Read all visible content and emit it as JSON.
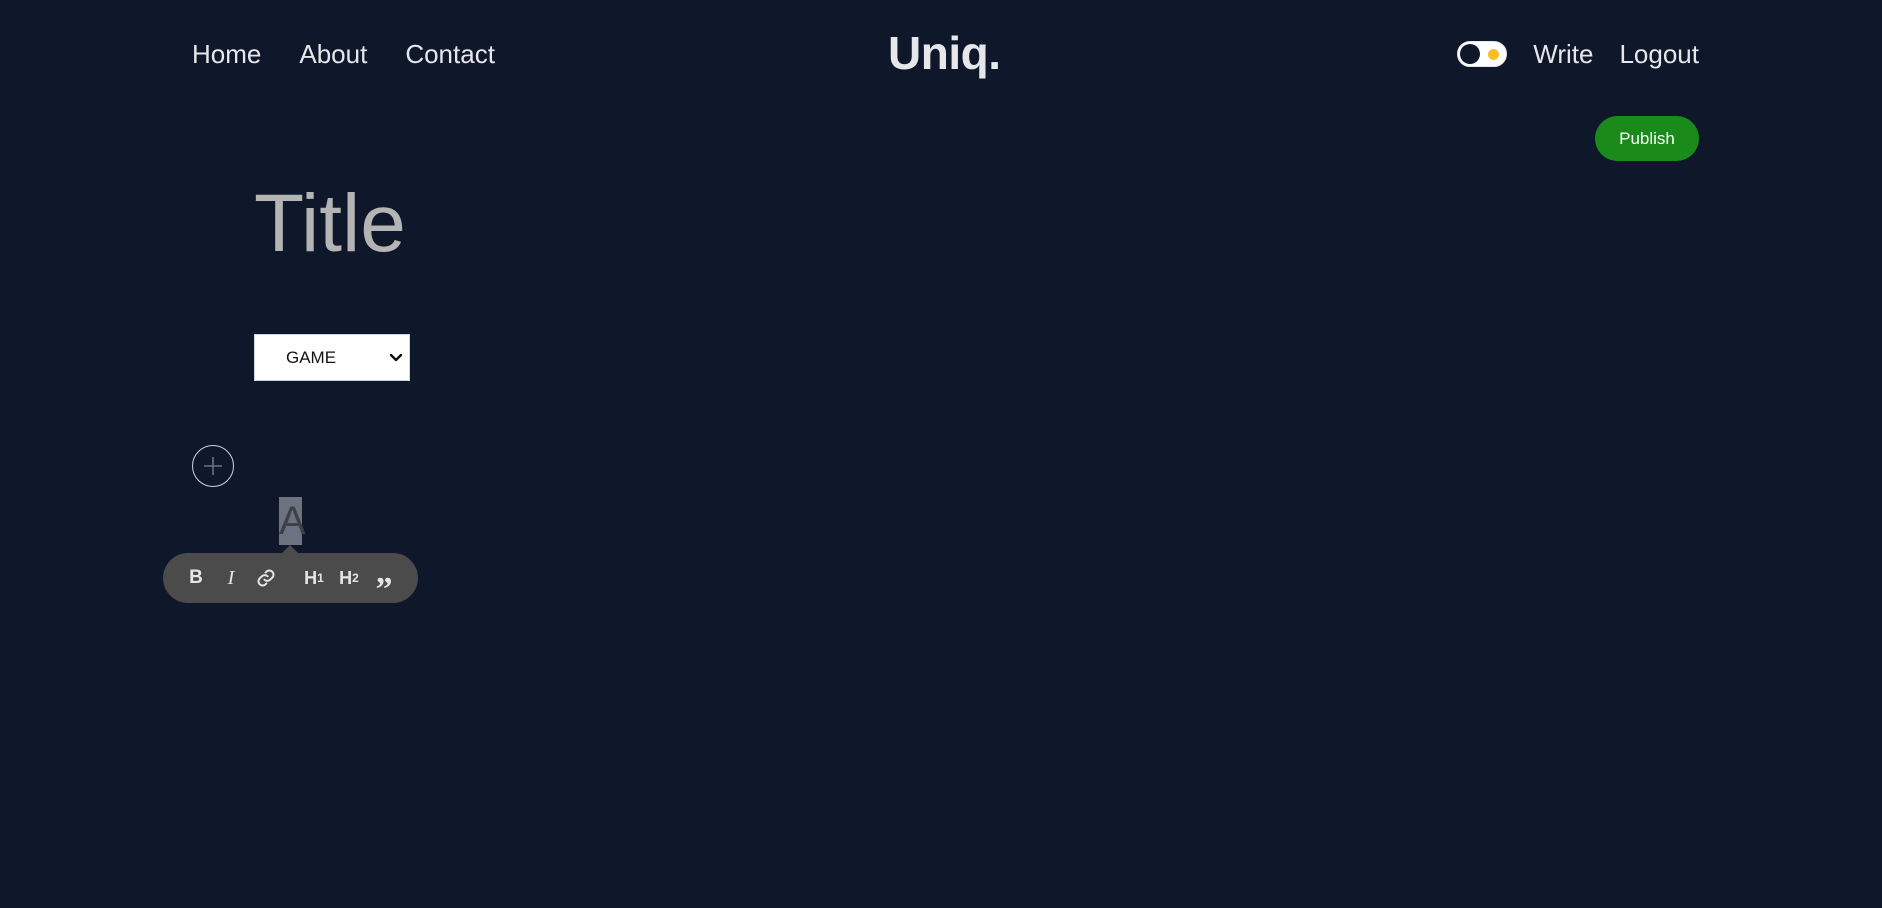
{
  "nav": {
    "links": [
      "Home",
      "About",
      "Contact"
    ],
    "logo": "Uniq.",
    "write_label": "Write",
    "logout_label": "Logout"
  },
  "publish": {
    "label": "Publish"
  },
  "editor": {
    "title_placeholder": "Title",
    "category": {
      "selected": "GAME"
    },
    "selected_text": "A",
    "toolbar": {
      "buttons": [
        "bold",
        "italic",
        "link",
        "heading-1",
        "heading-2",
        "quote"
      ],
      "bold_label": "B",
      "italic_label": "I",
      "h1_label": "H",
      "h1_sub": "1",
      "h2_label": "H",
      "h2_sub": "2",
      "quote_label": "”"
    }
  },
  "colors": {
    "background": "#0f172a",
    "publish": "#1a8a1a",
    "toolbar": "#4b4b4b",
    "toggle_sun": "#fbbf24"
  },
  "icons": [
    "plus-icon",
    "link-icon",
    "chevron-down-icon",
    "sun-icon"
  ]
}
